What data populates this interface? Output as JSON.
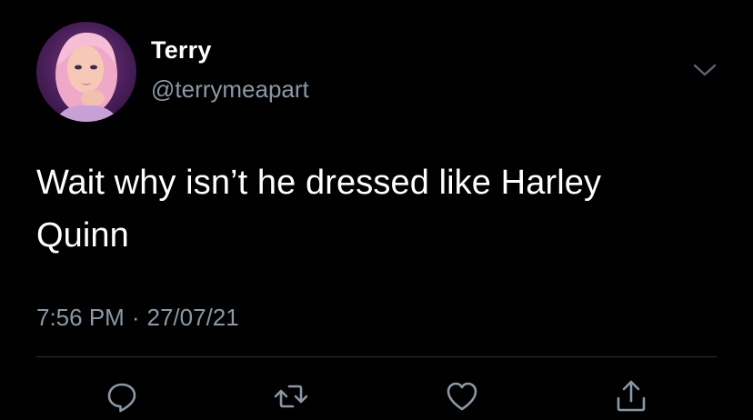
{
  "tweet": {
    "author": {
      "display_name": "Terry",
      "handle": "@terrymeapart"
    },
    "text_line1": "Wait why isn’t he dressed like Harley",
    "text_line2": "Quinn",
    "time": "7:56 PM",
    "date": "27/07/21"
  },
  "icons": {
    "menu": "chevron-down-icon",
    "reply": "reply-icon",
    "retweet": "retweet-icon",
    "like": "heart-icon",
    "share": "share-icon"
  },
  "colors": {
    "background": "#000000",
    "text": "#ffffff",
    "secondary": "#8b98a5",
    "divider": "#2f3336"
  }
}
